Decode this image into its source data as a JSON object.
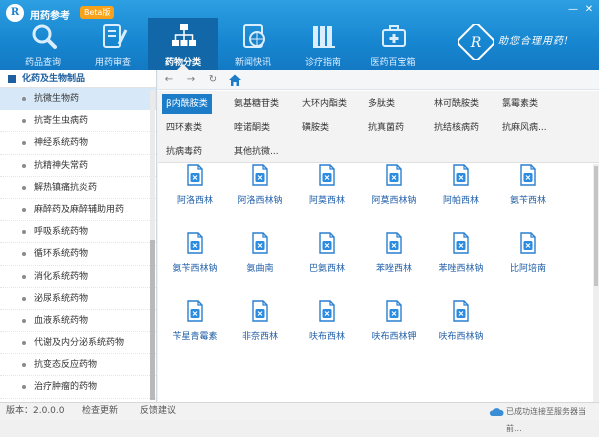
{
  "app": {
    "title": "用药参考",
    "beta": "Beta版",
    "logo": "R"
  },
  "window_controls": [
    "minimize-icon",
    "close-icon"
  ],
  "nav": [
    {
      "label": "药品查询",
      "icon": "magnifier-icon"
    },
    {
      "label": "用药审查",
      "icon": "checklist-pen-icon"
    },
    {
      "label": "药物分类",
      "icon": "hierarchy-icon",
      "active": true
    },
    {
      "label": "新闻快讯",
      "icon": "globe-doc-icon"
    },
    {
      "label": "诊疗指南",
      "icon": "books-icon"
    },
    {
      "label": "医药百宝箱",
      "icon": "medical-kit-icon"
    }
  ],
  "brand": {
    "slogan": "助您合理用药!"
  },
  "sidebar": {
    "header": "化药及生物制品",
    "items": [
      {
        "label": "抗微生物药",
        "active": true
      },
      {
        "label": "抗寄生虫病药"
      },
      {
        "label": "神经系统药物"
      },
      {
        "label": "抗精神失常药"
      },
      {
        "label": "解热镇痛抗炎药"
      },
      {
        "label": "麻醉药及麻醉辅助用药"
      },
      {
        "label": "呼吸系统药物"
      },
      {
        "label": "循环系统药物"
      },
      {
        "label": "消化系统药物"
      },
      {
        "label": "泌尿系统药物"
      },
      {
        "label": "血液系统药物"
      },
      {
        "label": "代谢及内分泌系统药物"
      },
      {
        "label": "抗变态反应药物"
      },
      {
        "label": "治疗肿瘤的药物"
      }
    ]
  },
  "toolbar": [
    "back-icon",
    "forward-icon",
    "refresh-icon",
    "home-icon"
  ],
  "categories": [
    {
      "label": "β内酰胺类",
      "active": true
    },
    {
      "label": "氨基糖苷类"
    },
    {
      "label": "大环内酯类"
    },
    {
      "label": "多肽类"
    },
    {
      "label": "林可酰胺类"
    },
    {
      "label": "氯霉素类"
    },
    {
      "label": "四环素类"
    },
    {
      "label": "喹诺酮类"
    },
    {
      "label": "磺胺类"
    },
    {
      "label": "抗真菌药"
    },
    {
      "label": "抗结核病药"
    },
    {
      "label": "抗麻风病..."
    },
    {
      "label": "抗病毒药"
    },
    {
      "label": "其他抗微..."
    }
  ],
  "drugs": [
    "阿洛西林",
    "阿洛西林钠",
    "阿莫西林",
    "阿莫西林钠",
    "阿帕西林",
    "氨苄西林",
    "氨苄西林钠",
    "氨曲南",
    "巴氨西林",
    "苯唑西林",
    "苯唑西林钠",
    "比阿培南",
    "苄星青霉素",
    "非奈西林",
    "呋布西林",
    "呋布西林钾",
    "呋布西林钠"
  ],
  "status": {
    "version": "版本：2.0.0.0",
    "check_update": "检查更新",
    "feedback": "反馈建议",
    "sync": "已成功连接至服务器当前..."
  }
}
